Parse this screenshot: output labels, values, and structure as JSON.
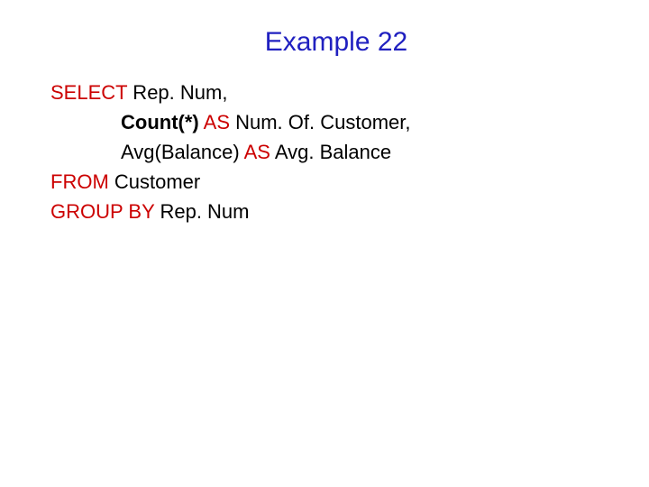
{
  "title": "Example 22",
  "code": {
    "l1": {
      "kw": "SELECT",
      "rest": " Rep. Num,"
    },
    "l2": {
      "kw": "Count(*)",
      "as": " AS ",
      "rest": "Num. Of. Customer,"
    },
    "l3": {
      "pre": "Avg(Balance) ",
      "as": "AS ",
      "rest": "Avg. Balance"
    },
    "l4": {
      "kw": "FROM",
      "rest": " Customer"
    },
    "l5": {
      "kw": "GROUP BY",
      "rest": " Rep. Num"
    }
  }
}
